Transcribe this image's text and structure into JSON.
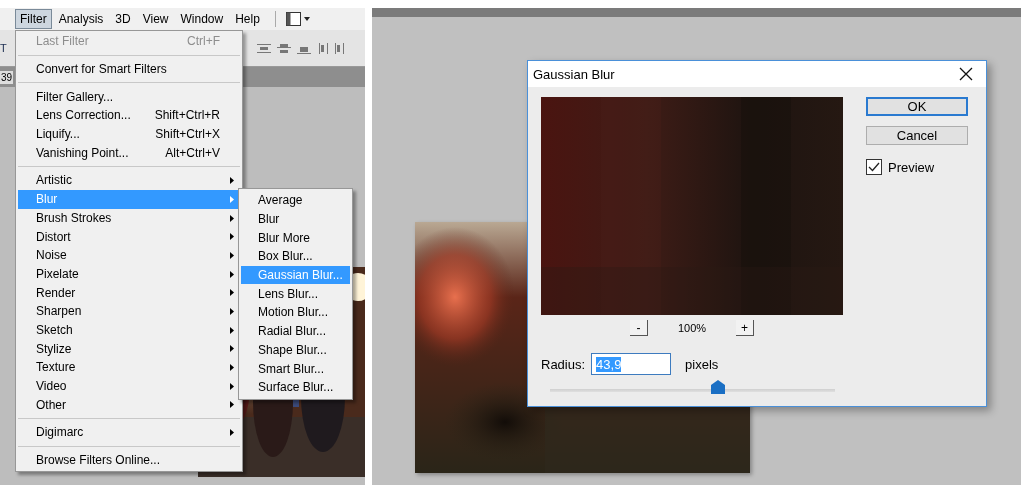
{
  "left_screenshot": {
    "toolbar_fragment": "T",
    "ruler_number": "39",
    "menu_bar": [
      {
        "label": "Filter",
        "selected": true
      },
      {
        "label": "Analysis",
        "selected": false
      },
      {
        "label": "3D",
        "selected": false
      },
      {
        "label": "View",
        "selected": false
      },
      {
        "label": "Window",
        "selected": false
      },
      {
        "label": "Help",
        "selected": false
      }
    ],
    "filter_menu": {
      "groups": [
        [
          {
            "label": "Last Filter",
            "shortcut": "Ctrl+F",
            "disabled": true,
            "has_submenu": false,
            "selected": false
          }
        ],
        [
          {
            "label": "Convert for Smart Filters",
            "disabled": false,
            "has_submenu": false,
            "selected": false
          }
        ],
        [
          {
            "label": "Filter Gallery...",
            "disabled": false,
            "has_submenu": false,
            "selected": false
          },
          {
            "label": "Lens Correction...",
            "shortcut": "Shift+Ctrl+R",
            "disabled": false,
            "has_submenu": false,
            "selected": false
          },
          {
            "label": "Liquify...",
            "shortcut": "Shift+Ctrl+X",
            "disabled": false,
            "has_submenu": false,
            "selected": false
          },
          {
            "label": "Vanishing Point...",
            "shortcut": "Alt+Ctrl+V",
            "disabled": false,
            "has_submenu": false,
            "selected": false
          }
        ],
        [
          {
            "label": "Artistic",
            "disabled": false,
            "has_submenu": true,
            "selected": false
          },
          {
            "label": "Blur",
            "disabled": false,
            "has_submenu": true,
            "selected": true
          },
          {
            "label": "Brush Strokes",
            "disabled": false,
            "has_submenu": true,
            "selected": false
          },
          {
            "label": "Distort",
            "disabled": false,
            "has_submenu": true,
            "selected": false
          },
          {
            "label": "Noise",
            "disabled": false,
            "has_submenu": true,
            "selected": false
          },
          {
            "label": "Pixelate",
            "disabled": false,
            "has_submenu": true,
            "selected": false
          },
          {
            "label": "Render",
            "disabled": false,
            "has_submenu": true,
            "selected": false
          },
          {
            "label": "Sharpen",
            "disabled": false,
            "has_submenu": true,
            "selected": false
          },
          {
            "label": "Sketch",
            "disabled": false,
            "has_submenu": true,
            "selected": false
          },
          {
            "label": "Stylize",
            "disabled": false,
            "has_submenu": true,
            "selected": false
          },
          {
            "label": "Texture",
            "disabled": false,
            "has_submenu": true,
            "selected": false
          },
          {
            "label": "Video",
            "disabled": false,
            "has_submenu": true,
            "selected": false
          },
          {
            "label": "Other",
            "disabled": false,
            "has_submenu": true,
            "selected": false
          }
        ],
        [
          {
            "label": "Digimarc",
            "disabled": false,
            "has_submenu": true,
            "selected": false
          }
        ],
        [
          {
            "label": "Browse Filters Online...",
            "disabled": false,
            "has_submenu": false,
            "selected": false
          }
        ]
      ]
    },
    "blur_submenu": {
      "items": [
        {
          "label": "Average",
          "selected": false
        },
        {
          "label": "Blur",
          "selected": false
        },
        {
          "label": "Blur More",
          "selected": false
        },
        {
          "label": "Box Blur...",
          "selected": false
        },
        {
          "label": "Gaussian Blur...",
          "selected": true
        },
        {
          "label": "Lens Blur...",
          "selected": false
        },
        {
          "label": "Motion Blur...",
          "selected": false
        },
        {
          "label": "Radial Blur...",
          "selected": false
        },
        {
          "label": "Shape Blur...",
          "selected": false
        },
        {
          "label": "Smart Blur...",
          "selected": false
        },
        {
          "label": "Surface Blur...",
          "selected": false
        }
      ]
    }
  },
  "right_screenshot": {
    "dialog": {
      "title": "Gaussian Blur",
      "zoom": "100%",
      "zoom_out": "-",
      "zoom_in": "+",
      "buttons": [
        {
          "label": "OK",
          "default": true
        },
        {
          "label": "Cancel",
          "default": false
        }
      ],
      "preview": {
        "label": "Preview",
        "checked": true
      },
      "radius": {
        "label": "Radius:",
        "value": "43,9",
        "unit": "pixels",
        "level": 0.59
      }
    }
  }
}
